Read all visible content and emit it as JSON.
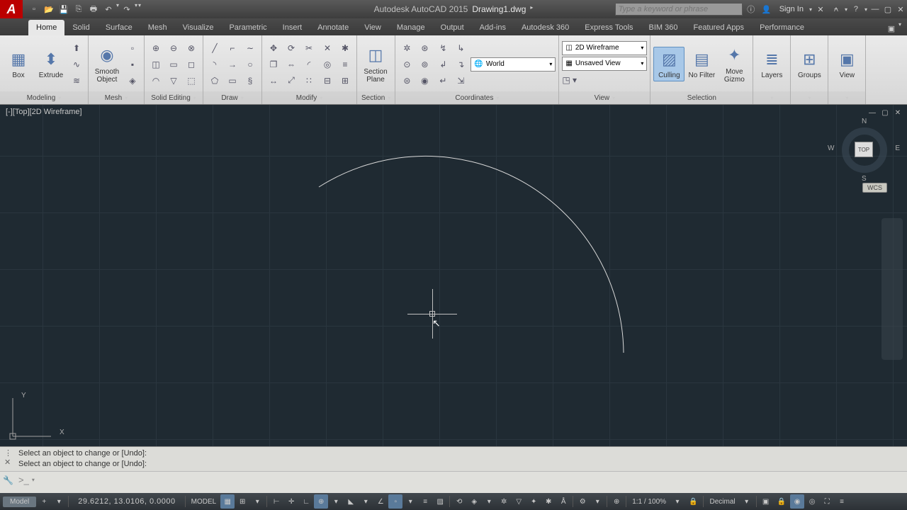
{
  "title": {
    "app": "Autodesk AutoCAD 2015",
    "file": "Drawing1.dwg"
  },
  "search": {
    "placeholder": "Type a keyword or phrase"
  },
  "signin": "Sign In",
  "tabs": [
    "Home",
    "Solid",
    "Surface",
    "Mesh",
    "Visualize",
    "Parametric",
    "Insert",
    "Annotate",
    "View",
    "Manage",
    "Output",
    "Add-ins",
    "Autodesk 360",
    "Express Tools",
    "BIM 360",
    "Featured Apps",
    "Performance"
  ],
  "active_tab": "Home",
  "ribbon": {
    "box": "Box",
    "extrude": "Extrude",
    "smooth": "Smooth Object",
    "section": "Section Plane",
    "culling": "Culling",
    "nofilter": "No Filter",
    "gizmo": "Move Gizmo",
    "layers": "Layers",
    "groups": "Groups",
    "view_big": "View",
    "visual_style": "2D Wireframe",
    "view_saved": "Unsaved View",
    "ucs": "World"
  },
  "panel_labels": {
    "modeling": "Modeling",
    "mesh": "Mesh",
    "solid_editing": "Solid Editing",
    "draw": "Draw",
    "modify": "Modify",
    "section": "Section",
    "coordinates": "Coordinates",
    "view": "View",
    "selection": "Selection"
  },
  "viewport": {
    "label": "[-][Top][2D Wireframe]",
    "cube": "TOP",
    "wcs": "WCS",
    "dirs": {
      "n": "N",
      "s": "S",
      "e": "E",
      "w": "W"
    },
    "axes": {
      "x": "X",
      "y": "Y"
    }
  },
  "command": {
    "hist1": "Select an object to change or [Undo]:",
    "hist2": "Select an object to change or [Undo]:",
    "prompt": ">_"
  },
  "status": {
    "tab": "Model",
    "coords": "29.6212, 13.0106, 0.0000",
    "model_btn": "MODEL",
    "scale": "1:1 / 100%",
    "units": "Decimal"
  }
}
